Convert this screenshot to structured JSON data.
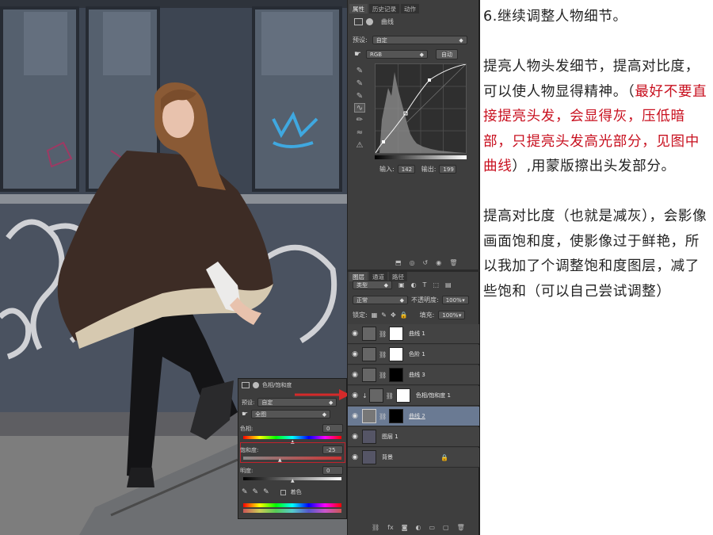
{
  "properties_panel": {
    "tabs": [
      "属性",
      "历史记录",
      "动作"
    ],
    "title": "曲线",
    "preset_label": "预设:",
    "preset_value": "自定",
    "channel_value": "RGB",
    "auto_button": "自动",
    "input_label": "输入:",
    "input_value": "142",
    "output_label": "输出:",
    "output_value": "199"
  },
  "layers_panel": {
    "tabs": [
      "图层",
      "通道",
      "路径"
    ],
    "filter_kind": "类型",
    "blend_mode": "正常",
    "opacity_label": "不透明度:",
    "opacity_value": "100%",
    "lock_label": "锁定:",
    "fill_label": "填充:",
    "fill_value": "100%",
    "layers": [
      {
        "name": "曲线 1",
        "type": "curves"
      },
      {
        "name": "色阶 1",
        "type": "levels"
      },
      {
        "name": "曲线 3",
        "type": "curves"
      },
      {
        "name": "色相/饱和度 1",
        "type": "hue"
      },
      {
        "name": "曲线 2",
        "type": "curves"
      },
      {
        "name": "图层 1",
        "type": "pixel"
      },
      {
        "name": "背景",
        "type": "pixel"
      }
    ]
  },
  "hue_sat_panel": {
    "title": "色相/饱和度",
    "preset_label": "预设:",
    "preset_value": "自定",
    "range_value": "全图",
    "hue_label": "色相:",
    "hue_value": "0",
    "saturation_label": "饱和度:",
    "saturation_value": "-25",
    "lightness_label": "明度:",
    "lightness_value": "0",
    "colorize_label": "着色"
  },
  "article": {
    "heading": "6.继续调整人物细节。",
    "p1_a": "提亮人物头发细节，提高对比度，可以使人物显得精神。（",
    "p1_red": "最好不要直接提亮头发，会显得灰，压低暗部，只提亮头发高光部分，见图中曲线",
    "p1_b": "）,用蒙版擦出头发部分。",
    "p2": "提高对比度（也就是减灰），会影像画面饱和度，使影像过于鲜艳，所以我加了个调整饱和度图层，减了些饱和（可以自己尝试调整）"
  },
  "colors": {
    "accent_red": "#c8101f",
    "panel_bg": "#3e3e3e",
    "selected_layer": "#6a7a93"
  }
}
